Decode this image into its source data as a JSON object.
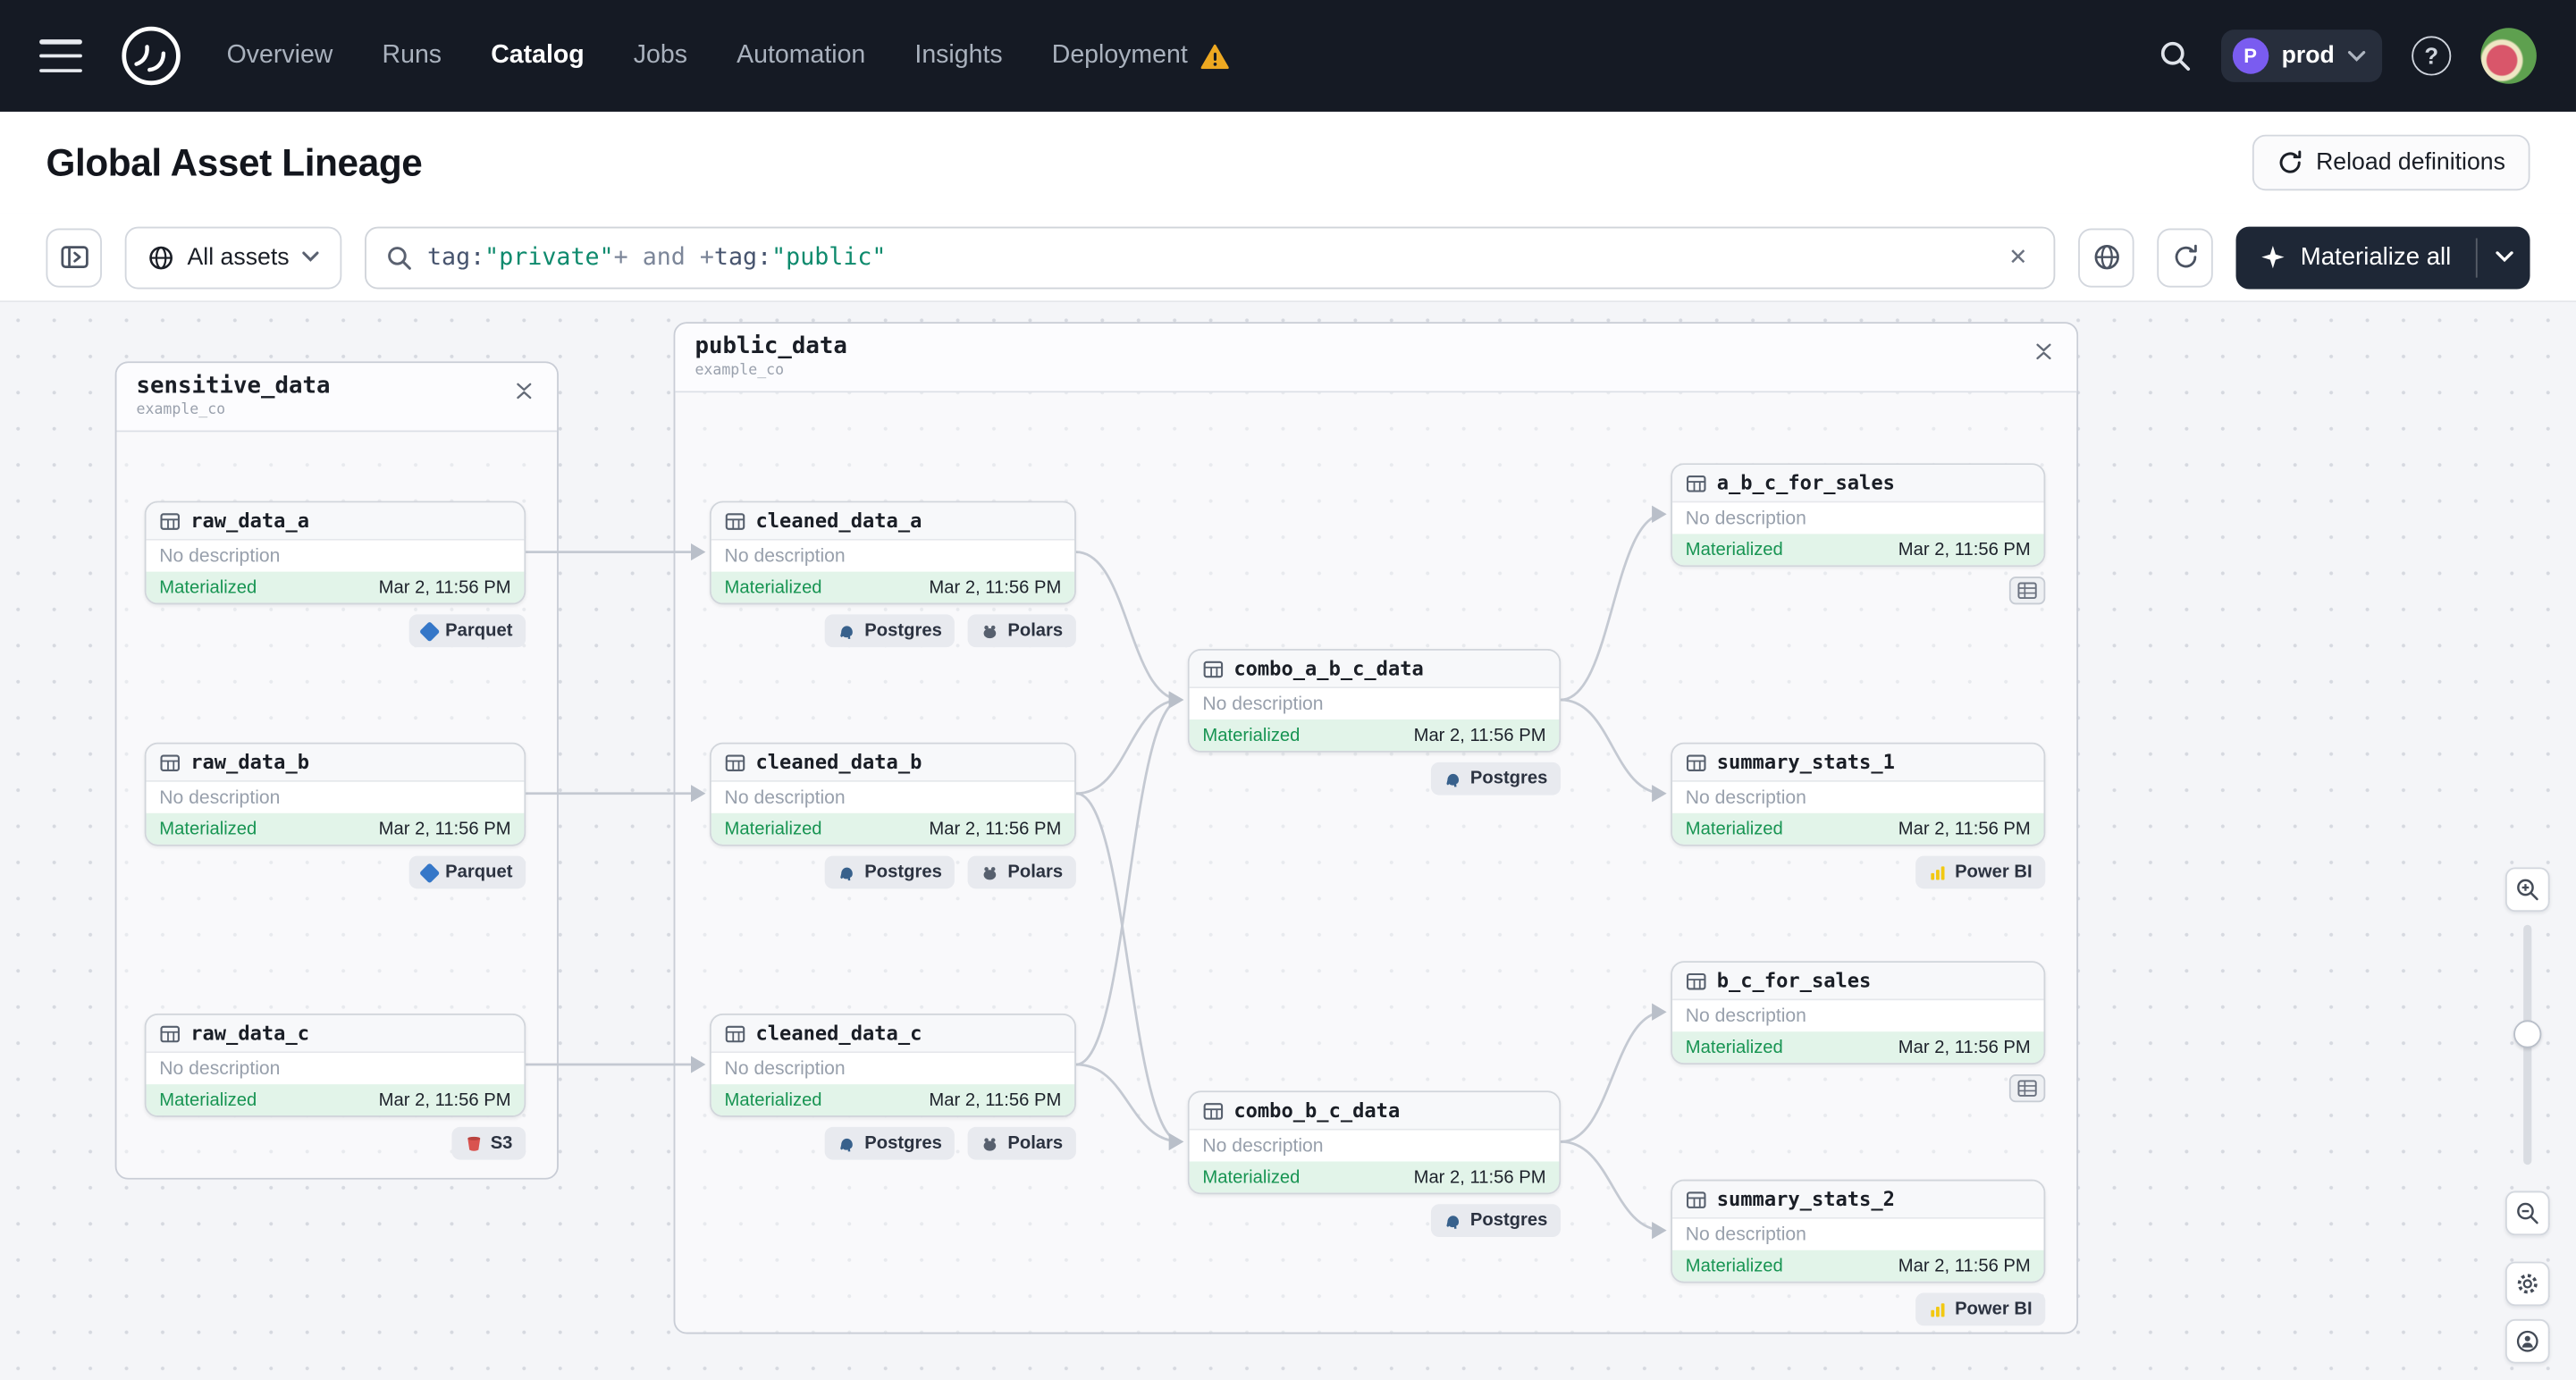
{
  "navbar": {
    "items": [
      "Overview",
      "Runs",
      "Catalog",
      "Jobs",
      "Automation",
      "Insights",
      "Deployment"
    ],
    "env": {
      "initial": "P",
      "name": "prod"
    }
  },
  "icons": {
    "clear": "✕",
    "help": "?"
  },
  "header": {
    "title": "Global Asset Lineage",
    "reload_label": "Reload definitions"
  },
  "toolbar": {
    "scope_label": "All assets",
    "query": {
      "key1": "tag:",
      "str1": "\"private\"",
      "op1": "+ and +",
      "key2": "tag:",
      "str2": "\"public\""
    },
    "materialize_label": "Materialize all"
  },
  "graph": {
    "groups": {
      "sensitive": {
        "name": "sensitive_data",
        "subtitle": "example_co"
      },
      "public": {
        "name": "public_data",
        "subtitle": "example_co"
      }
    },
    "nodes": {
      "raw_data_a": {
        "label": "raw_data_a",
        "description": "No description",
        "status": "Materialized",
        "time": "Mar 2, 11:56 PM",
        "tag1": "Parquet"
      },
      "raw_data_b": {
        "label": "raw_data_b",
        "description": "No description",
        "status": "Materialized",
        "time": "Mar 2, 11:56 PM",
        "tag1": "Parquet"
      },
      "raw_data_c": {
        "label": "raw_data_c",
        "description": "No description",
        "status": "Materialized",
        "time": "Mar 2, 11:56 PM",
        "tag1": "S3"
      },
      "cleaned_data_a": {
        "label": "cleaned_data_a",
        "description": "No description",
        "status": "Materialized",
        "time": "Mar 2, 11:56 PM",
        "tag1": "Postgres",
        "tag2": "Polars"
      },
      "cleaned_data_b": {
        "label": "cleaned_data_b",
        "description": "No description",
        "status": "Materialized",
        "time": "Mar 2, 11:56 PM",
        "tag1": "Postgres",
        "tag2": "Polars"
      },
      "cleaned_data_c": {
        "label": "cleaned_data_c",
        "description": "No description",
        "status": "Materialized",
        "time": "Mar 2, 11:56 PM",
        "tag1": "Postgres",
        "tag2": "Polars"
      },
      "combo_a_b_c_data": {
        "label": "combo_a_b_c_data",
        "description": "No description",
        "status": "Materialized",
        "time": "Mar 2, 11:56 PM",
        "tag1": "Postgres"
      },
      "combo_b_c_data": {
        "label": "combo_b_c_data",
        "description": "No description",
        "status": "Materialized",
        "time": "Mar 2, 11:56 PM",
        "tag1": "Postgres"
      },
      "a_b_c_for_sales": {
        "label": "a_b_c_for_sales",
        "description": "No description",
        "status": "Materialized",
        "time": "Mar 2, 11:56 PM"
      },
      "summary_stats_1": {
        "label": "summary_stats_1",
        "description": "No description",
        "status": "Materialized",
        "time": "Mar 2, 11:56 PM",
        "tag1": "Power BI"
      },
      "b_c_for_sales": {
        "label": "b_c_for_sales",
        "description": "No description",
        "status": "Materialized",
        "time": "Mar 2, 11:56 PM"
      },
      "summary_stats_2": {
        "label": "summary_stats_2",
        "description": "No description",
        "status": "Materialized",
        "time": "Mar 2, 11:56 PM",
        "tag1": "Power BI"
      }
    },
    "edges": [
      [
        "raw_data_a",
        "cleaned_data_a"
      ],
      [
        "raw_data_b",
        "cleaned_data_b"
      ],
      [
        "raw_data_c",
        "cleaned_data_c"
      ],
      [
        "cleaned_data_a",
        "combo_a_b_c_data"
      ],
      [
        "cleaned_data_b",
        "combo_a_b_c_data"
      ],
      [
        "cleaned_data_c",
        "combo_a_b_c_data"
      ],
      [
        "cleaned_data_b",
        "combo_b_c_data"
      ],
      [
        "cleaned_data_c",
        "combo_b_c_data"
      ],
      [
        "combo_a_b_c_data",
        "a_b_c_for_sales"
      ],
      [
        "combo_a_b_c_data",
        "summary_stats_1"
      ],
      [
        "combo_b_c_data",
        "b_c_for_sales"
      ],
      [
        "combo_b_c_data",
        "summary_stats_2"
      ]
    ]
  }
}
